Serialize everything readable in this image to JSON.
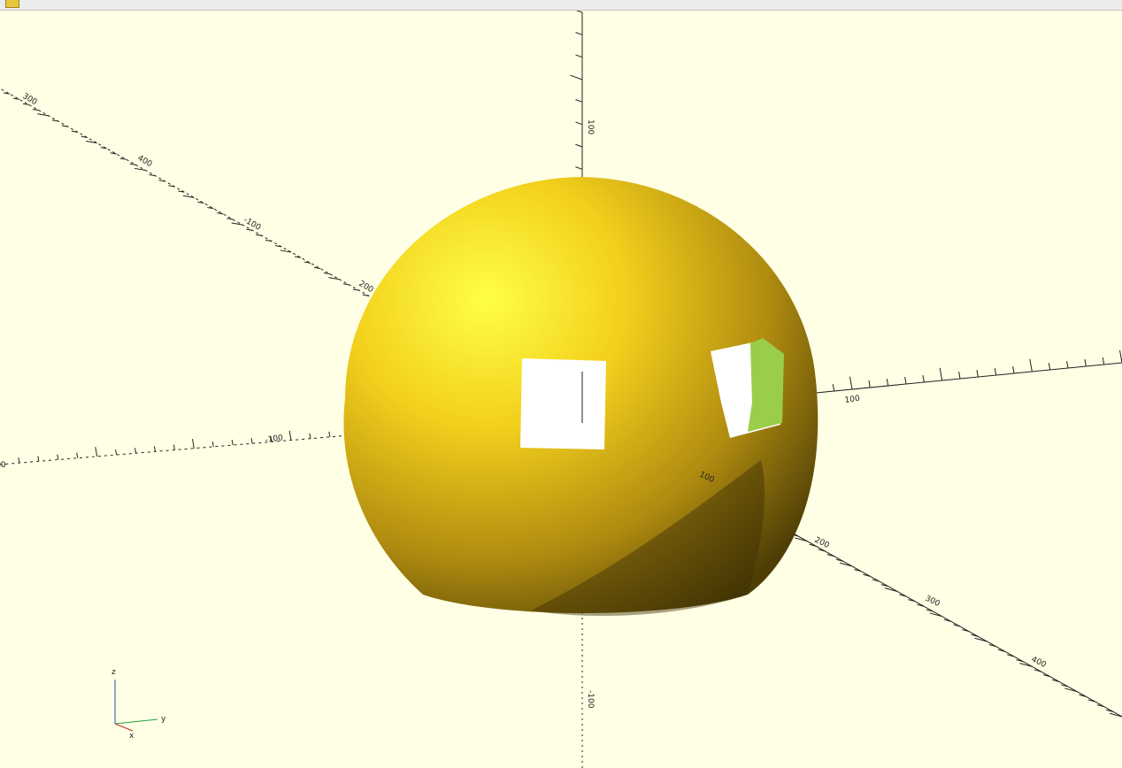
{
  "status_bar": {
    "text": "",
    "links": [
      "",
      ""
    ]
  },
  "viewport": {
    "background_color": "#ffffe5",
    "object_color": "#f5d90a",
    "cut_face_color": "#9acd4a",
    "axis_tick_labels": {
      "x_negative": [
        "200",
        "-100"
      ],
      "y_positive": [
        "100"
      ],
      "x_positive": [
        "100",
        "200",
        "300",
        "400"
      ],
      "y_negative": [
        "300",
        "400",
        "-100",
        "200"
      ],
      "z_positive": [
        "100"
      ],
      "z_negative": [
        "-100"
      ]
    },
    "orientation_gizmo": {
      "z_label": "z",
      "y_label": "y",
      "x_label": "x"
    }
  }
}
